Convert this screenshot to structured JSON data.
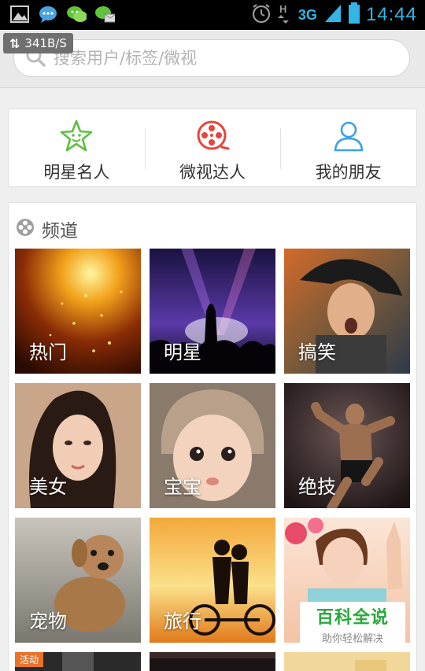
{
  "status_bar": {
    "network": "3G",
    "time": "14:44",
    "colors": {
      "accent": "#33b5e5"
    }
  },
  "speed_badge": {
    "text": "341B/S"
  },
  "search": {
    "placeholder": "搜索用户/标签/微视"
  },
  "quick_nav": [
    {
      "label": "明星名人",
      "icon": "star-face-icon",
      "color": "#5cbf40"
    },
    {
      "label": "微视达人",
      "icon": "film-reel-icon",
      "color": "#e8453c"
    },
    {
      "label": "我的朋友",
      "icon": "person-icon",
      "color": "#3ba0e8"
    }
  ],
  "channels": {
    "title": "频道",
    "tiles": [
      {
        "label": "热门"
      },
      {
        "label": "明星"
      },
      {
        "label": "搞笑"
      },
      {
        "label": "美女"
      },
      {
        "label": "宝宝"
      },
      {
        "label": "绝技"
      },
      {
        "label": "宠物"
      },
      {
        "label": "旅行"
      },
      {
        "label": ""
      }
    ],
    "promo": {
      "title": "百科全说",
      "subtitle": "助你轻松解决"
    },
    "activity_tag": "活动"
  }
}
